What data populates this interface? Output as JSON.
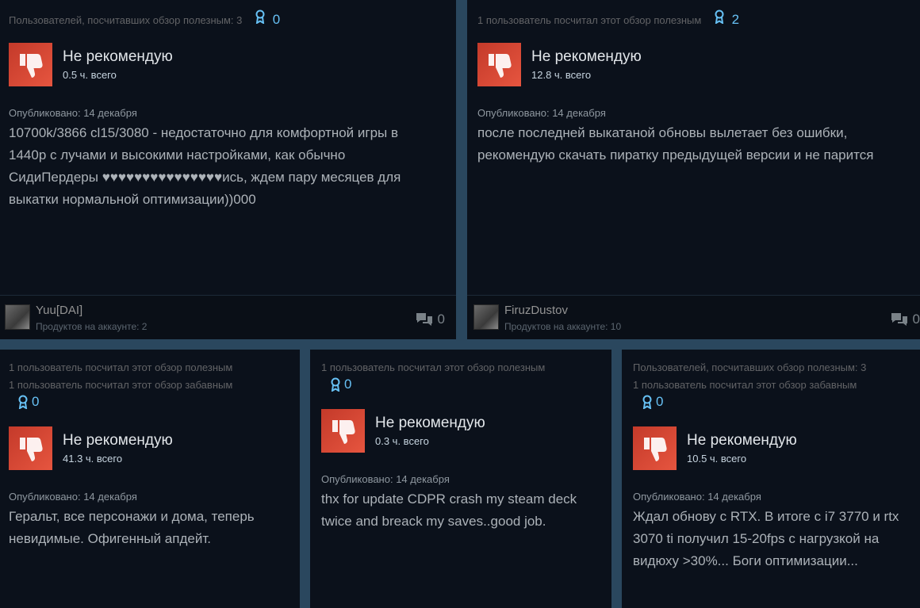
{
  "reviews": [
    {
      "helpful_lines": [
        "Пользователей, посчитавших обзор полезным: 3"
      ],
      "awards": "0",
      "verdict": "Не рекомендую",
      "hours": "0.5 ч. всего",
      "posted": "Опубликовано: 14 декабря",
      "text_lines": [
        "10700k/3866 cl15/3080 - недостаточно для комфортной игры в",
        "1440p с лучами и высокими настройками, как обычно",
        "СидиПердеры ♥♥♥♥♥♥♥♥♥♥♥♥♥♥♥ись, ждем пару месяцев для",
        "выкатки нормальной оптимизации))000"
      ],
      "author": "Yuu[DAI]",
      "products": "Продуктов на аккаунте: 2",
      "comments": "0"
    },
    {
      "helpful_lines": [
        "1 пользователь посчитал этот обзор полезным"
      ],
      "awards": "2",
      "verdict": "Не рекомендую",
      "hours": "12.8 ч. всего",
      "posted": "Опубликовано: 14 декабря",
      "text_lines": [
        "после последней выкатаной обновы вылетает без ошибки,",
        "рекомендую скачать пиратку предыдущей версии и не парится"
      ],
      "author": "FiruzDustov",
      "products": "Продуктов на аккаунте: 10",
      "comments": "0"
    },
    {
      "helpful_lines": [
        "1 пользователь посчитал этот обзор полезным",
        "1 пользователь посчитал этот обзор забавным"
      ],
      "awards": "0",
      "verdict": "Не рекомендую",
      "hours": "41.3 ч. всего",
      "posted": "Опубликовано: 14 декабря",
      "text_lines": [
        "Геральт, все персонажи и дома, теперь",
        "невидимые. Офигенный апдейт."
      ]
    },
    {
      "helpful_lines": [
        "1 пользователь посчитал этот обзор полезным"
      ],
      "awards": "0",
      "verdict": "Не рекомендую",
      "hours": "0.3 ч. всего",
      "posted": "Опубликовано: 14 декабря",
      "text_lines": [
        "thx for update CDPR crash my steam deck",
        "twice and breack my saves..good job."
      ]
    },
    {
      "helpful_lines": [
        "Пользователей, посчитавших обзор полезным: 3",
        "1 пользователь посчитал этот обзор забавным"
      ],
      "awards": "0",
      "verdict": "Не рекомендую",
      "hours": "10.5 ч. всего",
      "posted": "Опубликовано: 14 декабря",
      "text_lines": [
        "Ждал обнову с RTX. В итоге с i7 3770 и rtx",
        "3070 ti получил 15-20fps с нагрузкой на",
        "видюху >30%... Боги оптимизации..."
      ]
    }
  ],
  "colors": {
    "background": "#2a475e",
    "card": "#0b111b",
    "thumb": "#d9432f",
    "award": "#67c1f5"
  },
  "icons": {
    "thumb": "thumbs-down-icon",
    "award": "award-ribbon-icon",
    "comments": "comment-bubbles-icon"
  }
}
